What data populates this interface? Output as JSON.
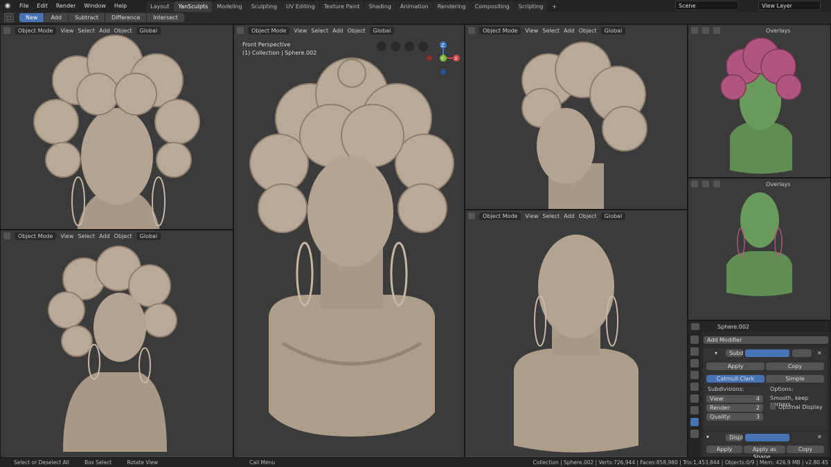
{
  "menu": [
    "File",
    "Edit",
    "Render",
    "Window",
    "Help"
  ],
  "workspaces": [
    "Layout",
    "YanSculpts",
    "Modeling",
    "Sculpting",
    "UV Editing",
    "Texture Paint",
    "Shading",
    "Animation",
    "Rendering",
    "Compositing",
    "Scripting",
    "+"
  ],
  "scene": "Scene",
  "view_layer": "View Layer",
  "tool_modes": [
    "New",
    "Add",
    "Subtract",
    "Difference",
    "Intersect"
  ],
  "viewport_header": {
    "mode": "Object Mode",
    "menus": [
      "View",
      "Select",
      "Add",
      "Object"
    ],
    "orientation": "Global",
    "overlays": "Overlays"
  },
  "main_view": {
    "title": "Front Perspective",
    "subtitle": "(1) Collection | Sphere.002",
    "gizmo": {
      "z": "Z",
      "y": "Y",
      "x": "X"
    }
  },
  "properties": {
    "object": "Sphere.002",
    "add_modifier": "Add Modifier",
    "mod1": "Subd",
    "apply": "Apply",
    "copy": "Copy",
    "catmull": "Catmull-Clark",
    "simple": "Simple",
    "subdivisions": "Subdivisions:",
    "options": "Options:",
    "view_label": "View:",
    "view_val": "4",
    "render_label": "Render:",
    "render_val": "2",
    "quality_label": "Quality:",
    "quality_val": "3",
    "uv": "Smooth, keep corners",
    "optimal": "Optimal Display",
    "mod2": "Displ",
    "apply2": "Apply",
    "apply_shape": "Apply as Shape...",
    "copy2": "Copy"
  },
  "status": {
    "select": "Select or Deselect All",
    "box": "Box Select",
    "rotate": "Rotate View",
    "call": "Call Menu",
    "stats": "Collection | Sphere.002 | Verts:726,944 | Faces:858,980 | Tris:1,453,844 | Objects:0/9 | Mem: 426.9 MB | v2.80.45"
  },
  "colors": {
    "clay": "#b7a793",
    "hair_pink": "#b0567e",
    "skin_green": "#5f8d52",
    "accent": "#4772b3"
  }
}
